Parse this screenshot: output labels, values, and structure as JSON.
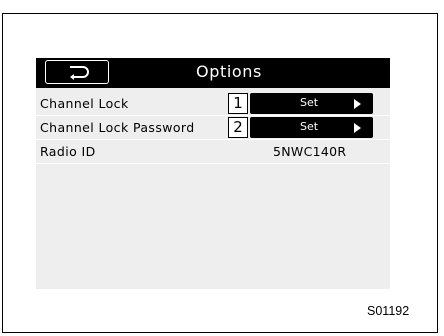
{
  "header": {
    "title": "Options",
    "back_icon": "return-arrow-icon"
  },
  "rows": [
    {
      "label": "Channel Lock",
      "number": "1",
      "button_label": "Set",
      "button_icon": "triangle-right-icon"
    },
    {
      "label": "Channel Lock Password",
      "number": "2",
      "button_label": "Set",
      "button_icon": "triangle-right-icon"
    },
    {
      "label": "Radio ID",
      "value": "5NWC140R"
    }
  ],
  "figure_code": "S01192",
  "colors": {
    "header_bg": "#000000",
    "screen_bg": "#eeeeee",
    "button_bg": "#000000",
    "text": "#000000"
  }
}
